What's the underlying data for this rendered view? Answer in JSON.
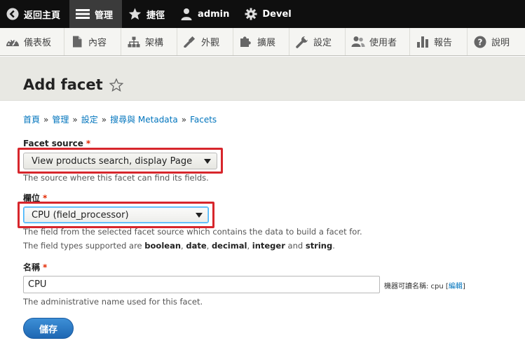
{
  "toolbar": {
    "items": [
      {
        "label": "返回主頁",
        "icon": "back-circle-icon"
      },
      {
        "label": "管理",
        "icon": "hamburger-icon"
      },
      {
        "label": "捷徑",
        "icon": "star-icon"
      },
      {
        "label": "admin",
        "icon": "user-icon"
      },
      {
        "label": "Devel",
        "icon": "gear-icon"
      }
    ]
  },
  "tray": {
    "items": [
      {
        "label": "儀表板",
        "icon": "dashboard-icon"
      },
      {
        "label": "內容",
        "icon": "document-icon"
      },
      {
        "label": "架構",
        "icon": "structure-icon"
      },
      {
        "label": "外觀",
        "icon": "brush-icon"
      },
      {
        "label": "擴展",
        "icon": "puzzle-icon"
      },
      {
        "label": "設定",
        "icon": "wrench-icon"
      },
      {
        "label": "使用者",
        "icon": "people-icon"
      },
      {
        "label": "報告",
        "icon": "bar-chart-icon"
      },
      {
        "label": "說明",
        "icon": "help-icon"
      }
    ]
  },
  "page": {
    "title": "Add facet"
  },
  "breadcrumb": {
    "items": [
      "首頁",
      "管理",
      "設定",
      "搜尋與 Metadata",
      "Facets"
    ],
    "separator": "»"
  },
  "form": {
    "facet_source": {
      "label": "Facet source",
      "required_mark": "*",
      "value": "View products search, display Page",
      "description": "The source where this facet can find its fields."
    },
    "field": {
      "label": "欄位",
      "required_mark": "*",
      "value": "CPU (field_processor)",
      "description_line1": "The field from the selected facet source which contains the data to build a facet for.",
      "description_line2_prefix": "The field types supported are ",
      "types": [
        "boolean",
        "date",
        "decimal",
        "integer"
      ],
      "types_and": "and",
      "types_last": "string",
      "types_end": "."
    },
    "name": {
      "label": "名稱",
      "required_mark": "*",
      "value": "CPU",
      "machine_label": "機器可讀名稱: cpu",
      "machine_edit": "編輯",
      "description": "The administrative name used for this facet."
    },
    "save_label": "儲存"
  },
  "colors": {
    "toolbar_bg": "#0f0f0f",
    "link": "#0074bd",
    "required": "#e32700",
    "highlight": "#d7262c",
    "button": "#1e67b3"
  }
}
